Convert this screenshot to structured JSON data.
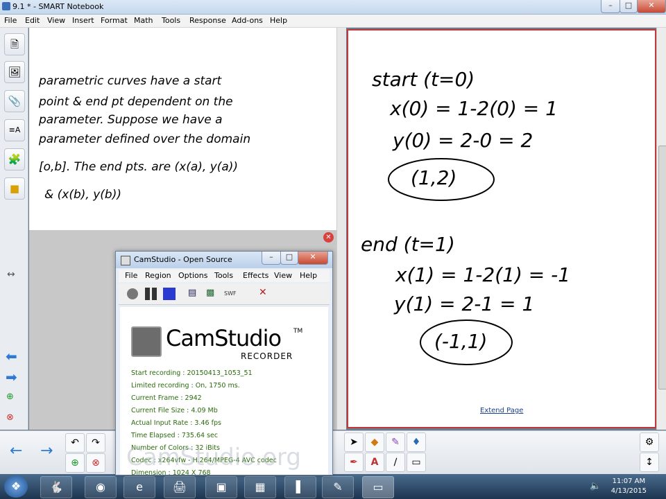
{
  "window": {
    "title": "9.1 * - SMART Notebook"
  },
  "menu": [
    "File",
    "Edit",
    "View",
    "Insert",
    "Format",
    "Math",
    "Tools",
    "Response",
    "Add-ons",
    "Help"
  ],
  "left_note": {
    "lines": [
      "parametric curves have a start",
      "point & end pt dependent on the",
      "parameter. Suppose we have a",
      "parameter defined over the domain",
      "[o,b]. The end pts. are (x(a), y(a))",
      "& (x(b), y(b))"
    ]
  },
  "right_note": {
    "lines": [
      "start (t=0)",
      "x(0) = 1-2(0) = 1",
      "y(0) = 2-0 = 2",
      "(1,2)",
      "end (t=1)",
      "x(1) = 1-2(1) = -1",
      "y(1) = 2-1 = 1",
      "(-1,1)"
    ]
  },
  "extend_page": "Extend Page",
  "camstudio": {
    "title": "CamStudio - Open Source",
    "menu": [
      "File",
      "Region",
      "Options",
      "Tools",
      "Effects",
      "View",
      "Help"
    ],
    "brand": "CamStudio",
    "tm": "TM",
    "recorder": "RECORDER",
    "stats": [
      "Start recording : 20150413_1053_51",
      "Limited recording : On, 1750 ms.",
      "Current Frame : 2942",
      "Current File Size : 4.09 Mb",
      "Actual Input Rate : 3.46 fps",
      "Time Elapsed : 735.64 sec",
      "Number of Colors : 32 iBits",
      "Codec : x264vfw - H.264/MPEG-4 AVC codec",
      "Dimension : 1024 X 768"
    ],
    "watermark": "CamStudio.org"
  },
  "clock": {
    "time": "11:07 AM",
    "date": "4/13/2015"
  },
  "colors": {
    "page_border": "#c0393b",
    "stat_text": "#2a6a0a",
    "link": "#1a3f8f"
  }
}
